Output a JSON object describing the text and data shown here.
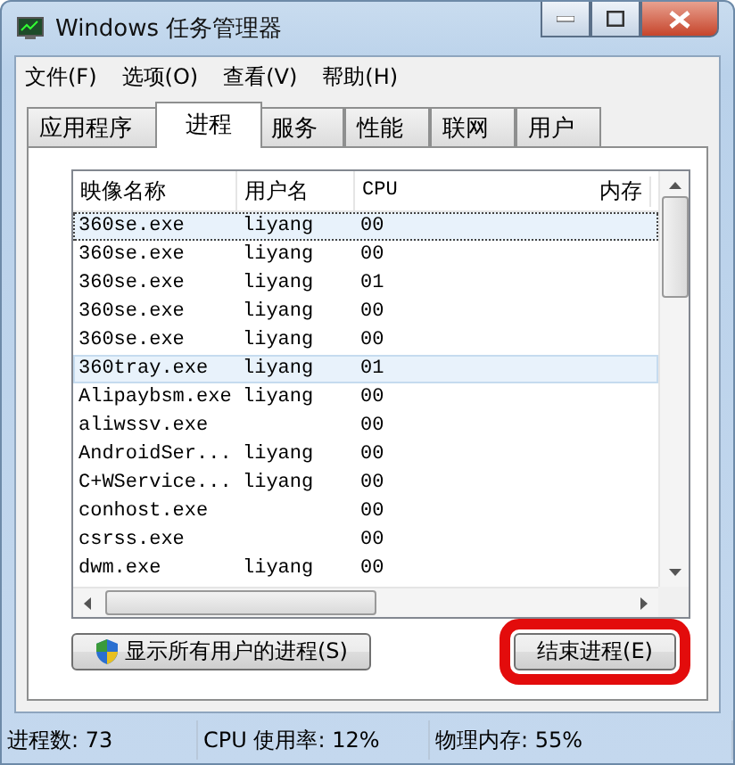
{
  "window": {
    "title": "Windows 任务管理器"
  },
  "menu": [
    "文件(F)",
    "选项(O)",
    "查看(V)",
    "帮助(H)"
  ],
  "tabs": [
    {
      "label": "应用程序",
      "selected": false
    },
    {
      "label": "进程",
      "selected": true
    },
    {
      "label": "服务",
      "selected": false
    },
    {
      "label": "性能",
      "selected": false
    },
    {
      "label": "联网",
      "selected": false
    },
    {
      "label": "用户",
      "selected": false
    }
  ],
  "table": {
    "columns": [
      "映像名称",
      "用户名",
      "CPU",
      "内存"
    ],
    "rows": [
      {
        "cells": [
          "360se.exe",
          "liyang",
          "00"
        ],
        "selected": true,
        "focused": true
      },
      {
        "cells": [
          "360se.exe",
          "liyang",
          "00"
        ],
        "selected": false,
        "focused": false
      },
      {
        "cells": [
          "360se.exe",
          "liyang",
          "01"
        ],
        "selected": false,
        "focused": false
      },
      {
        "cells": [
          "360se.exe",
          "liyang",
          "00"
        ],
        "selected": false,
        "focused": false
      },
      {
        "cells": [
          "360se.exe",
          "liyang",
          "00"
        ],
        "selected": false,
        "focused": false
      },
      {
        "cells": [
          "360tray.exe",
          "liyang",
          "01"
        ],
        "selected": true,
        "focused": false
      },
      {
        "cells": [
          "Alipaybsm.exe",
          "liyang",
          "00"
        ],
        "selected": false,
        "focused": false
      },
      {
        "cells": [
          "aliwssv.exe",
          "",
          "00"
        ],
        "selected": false,
        "focused": false
      },
      {
        "cells": [
          "AndroidSer...",
          "liyang",
          "00"
        ],
        "selected": false,
        "focused": false
      },
      {
        "cells": [
          "C+WService...",
          "liyang",
          "00"
        ],
        "selected": false,
        "focused": false
      },
      {
        "cells": [
          "conhost.exe",
          "",
          "00"
        ],
        "selected": false,
        "focused": false
      },
      {
        "cells": [
          "csrss.exe",
          "",
          "00"
        ],
        "selected": false,
        "focused": false
      },
      {
        "cells": [
          "dwm.exe",
          "liyang",
          "00"
        ],
        "selected": false,
        "focused": false
      }
    ]
  },
  "buttons": [
    {
      "label": "显示所有用户的进程(S)",
      "kind": "shield"
    },
    {
      "label": "结束进程(E)",
      "kind": "highlighted"
    }
  ],
  "status_bar": [
    "进程数: 73",
    "CPU 使用率: 12%",
    "物理内存: 55%"
  ]
}
